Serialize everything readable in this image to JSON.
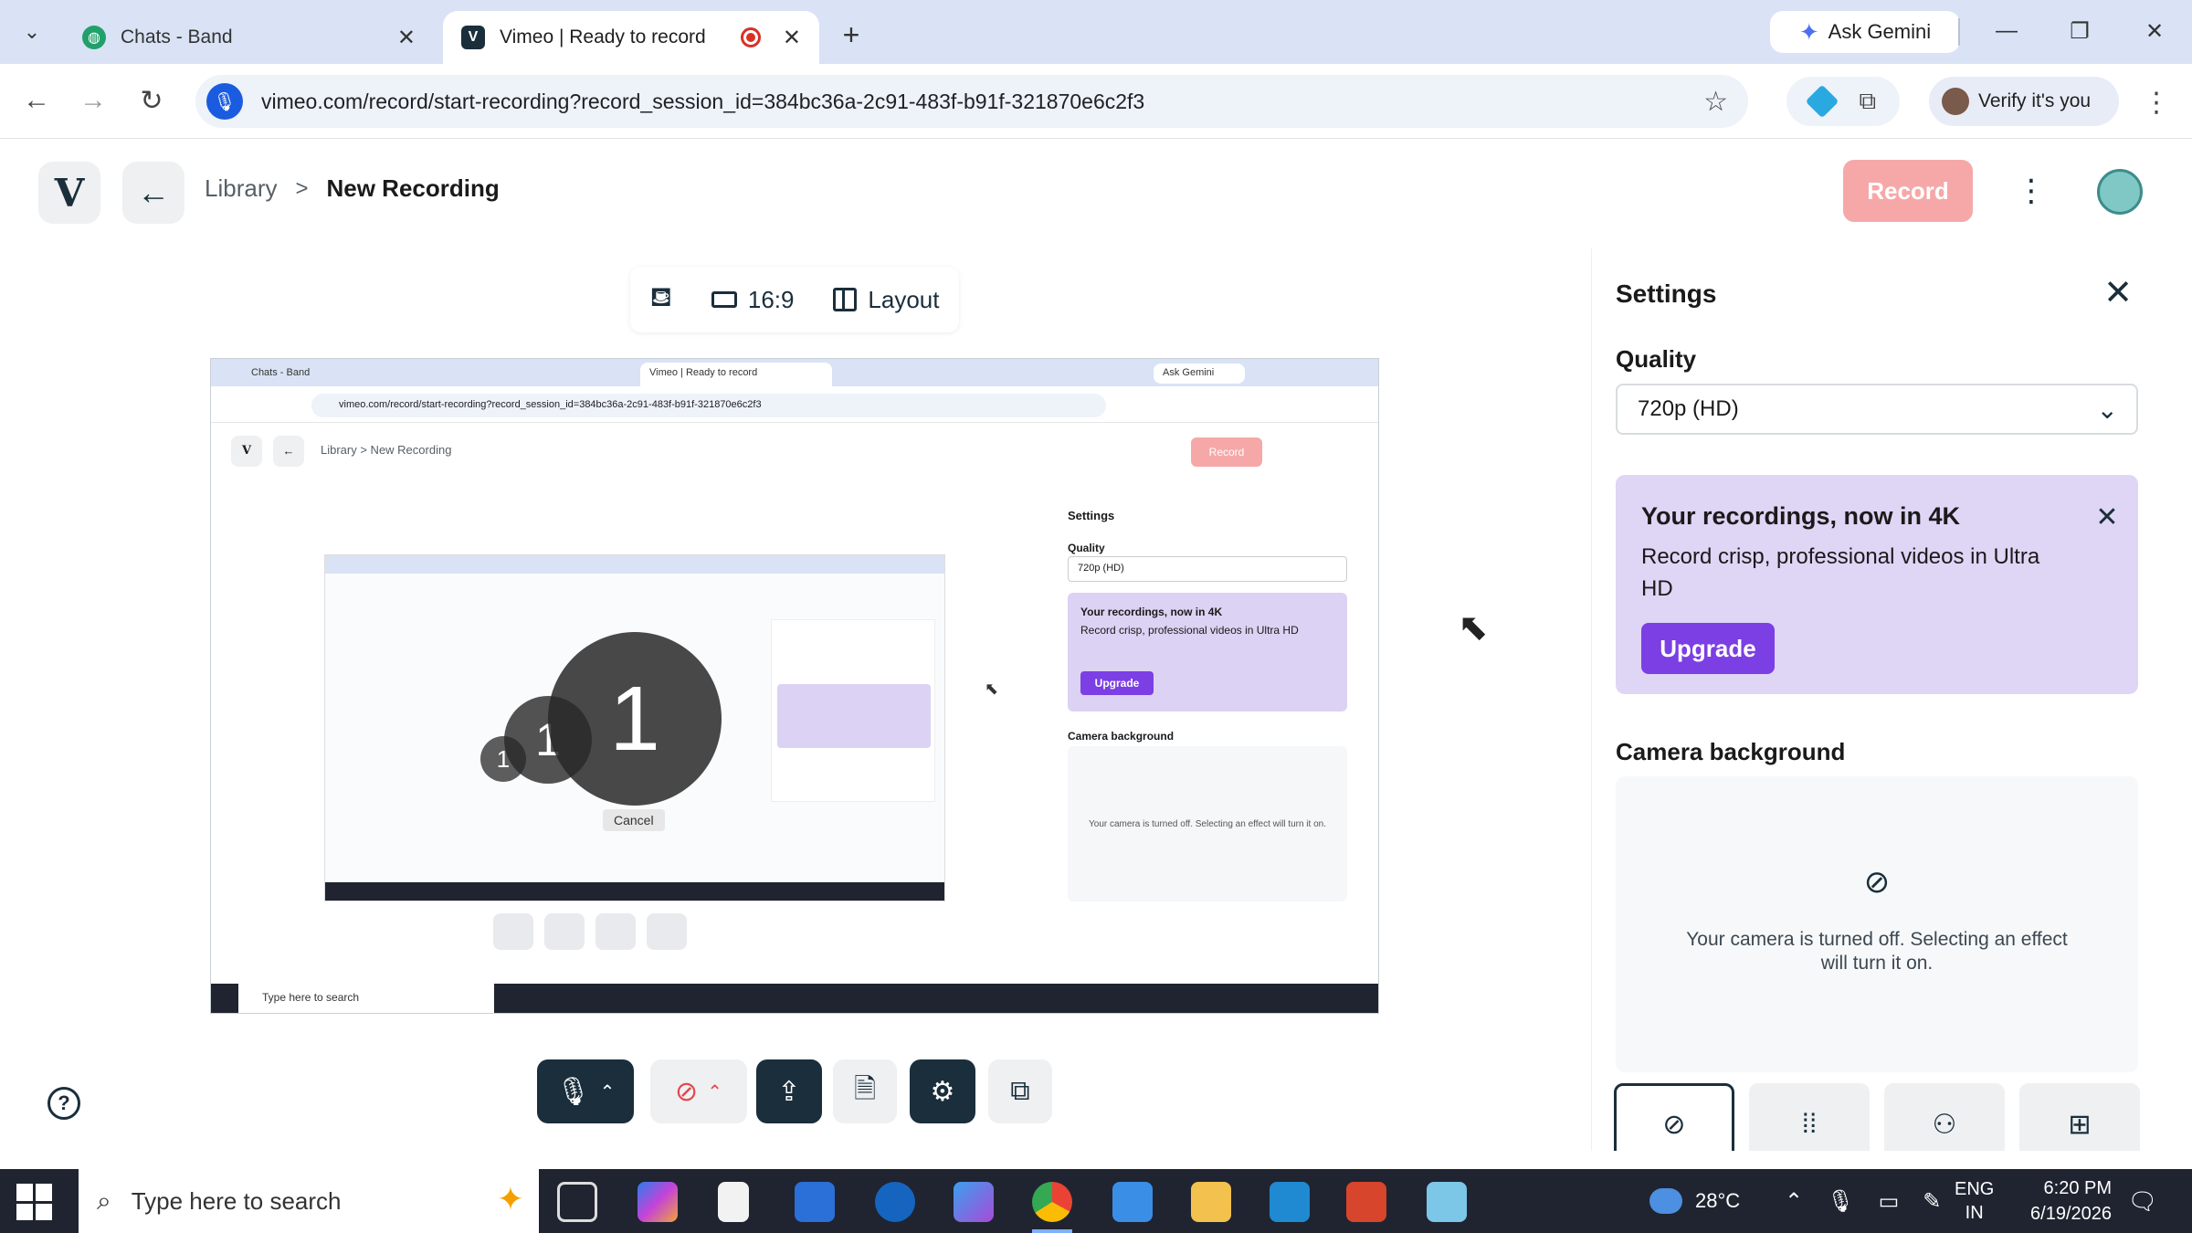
{
  "browser": {
    "tabs": [
      {
        "title": "Chats - Band",
        "active": false
      },
      {
        "title": "Vimeo | Ready to record",
        "active": true
      }
    ],
    "gemini_label": "Ask Gemini",
    "url": "vimeo.com/record/start-recording?record_session_id=384bc36a-2c91-483f-b91f-321870e6c2f3",
    "verify_label": "Verify it's you"
  },
  "app": {
    "logo": "V",
    "breadcrumb": {
      "library": "Library",
      "separator": ">",
      "current": "New Recording"
    },
    "record_label": "Record",
    "canvas_toolbar": {
      "aspect": "16:9",
      "layout": "Layout"
    },
    "countdown": {
      "large": "1",
      "medium": "1",
      "small": "1"
    },
    "preview": {
      "tab_inactive": "Chats - Band",
      "tab_active": "Vimeo | Ready to record",
      "gemini": "Ask Gemini",
      "url": "vimeo.com/record/start-recording?record_session_id=384bc36a-2c91-483f-b91f-321870e6c2f3",
      "crumb": "Library  >  New Recording",
      "record": "Record",
      "settings_title": "Settings",
      "quality": "Quality",
      "quality_value": "720p (HD)",
      "promo_title": "Your recordings, now in 4K",
      "promo_body": "Record crisp, professional videos in Ultra HD",
      "upgrade": "Upgrade",
      "camera_bg": "Camera background",
      "camera_msg": "Your camera is turned off. Selecting an effect will turn it on.",
      "cancel": "Cancel",
      "search": "Type here to search"
    }
  },
  "settings": {
    "title": "Settings",
    "quality_label": "Quality",
    "quality_value": "720p (HD)",
    "promo": {
      "title": "Your recordings, now in 4K",
      "body": "Record crisp, professional videos in Ultra HD",
      "cta": "Upgrade"
    },
    "camera_background_label": "Camera background",
    "camera_message": "Your camera is turned off. Selecting an effect will turn it on."
  },
  "taskbar": {
    "search_placeholder": "Type here to search",
    "temperature": "28°C",
    "language": "ENG",
    "region": "IN",
    "time": "6:20 PM",
    "date": "6/19/2026"
  },
  "colors": {
    "accent_purple": "#7b3fe4",
    "record_pink": "#f6a8a8",
    "camera_off_red": "#e2474f",
    "vimeo_dark": "#1a2e3b"
  }
}
